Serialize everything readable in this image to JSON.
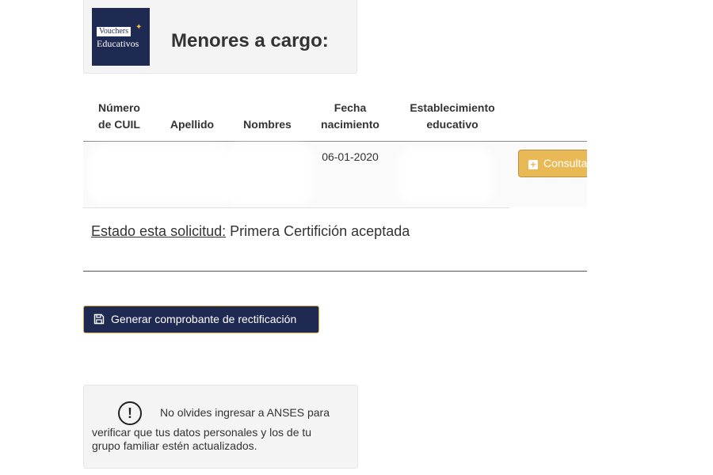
{
  "header": {
    "logo_line1": "Vouchers",
    "logo_line2": "Educativos",
    "title": "Menores a cargo:"
  },
  "table": {
    "columns": {
      "cuil_1": "Número",
      "cuil_2": "de CUIL",
      "apellido": "Apellido",
      "nombres": "Nombres",
      "fecha_1": "Fecha",
      "fecha_2": "nacimiento",
      "estab_1": "Establecimiento",
      "estab_2": "educativo"
    },
    "rows": [
      {
        "fecha_nacimiento": "06-01-2020",
        "action_label": "Consultar"
      }
    ]
  },
  "estado": {
    "label": "Estado esta solicitud:",
    "value": "Primera Certifición aceptada"
  },
  "actions": {
    "generate_label": "Generar comprobante de rectificación"
  },
  "notice": {
    "line1": "No olvides ingresar a ANSES para",
    "line2": "verificar que tus datos personales y los de tu",
    "line3": "grupo familiar estén actualizados."
  },
  "icons": {
    "consult": "plus-square-icon",
    "generate": "save-icon",
    "notice": "exclamation-circle-icon"
  },
  "colors": {
    "brand_navy": "#1f2a52",
    "consult_button": "#e8b954",
    "button_border": "#d8a541"
  }
}
